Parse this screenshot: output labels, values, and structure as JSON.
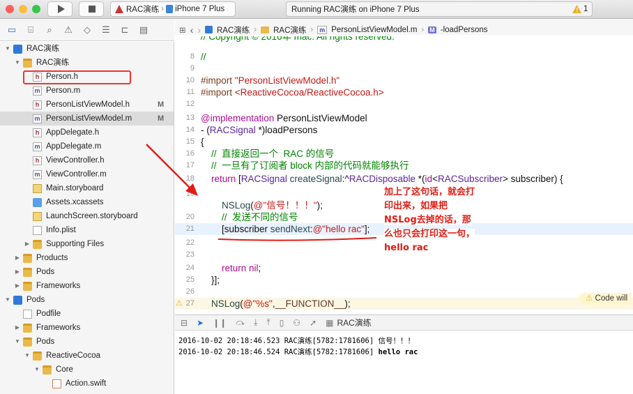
{
  "toolbar": {
    "target_name": "RAC演练",
    "device_name": "iPhone 7 Plus",
    "status_text": "Running RAC演练 on iPhone 7 Plus",
    "warning_count": "1",
    "colors": {
      "close": "#fc605b",
      "minimize": "#fdbc40",
      "zoom": "#34c84a"
    }
  },
  "navigator": {
    "items": [
      {
        "label": "RAC演练",
        "icon": "project-icon",
        "indent": 0,
        "disclosure": "open",
        "badge": ""
      },
      {
        "label": "RAC演练",
        "icon": "folder-icon",
        "indent": 1,
        "disclosure": "open",
        "badge": ""
      },
      {
        "label": "Person.h",
        "icon": "h-file-icon",
        "indent": 2,
        "disclosure": "",
        "badge": ""
      },
      {
        "label": "Person.m",
        "icon": "m-file-icon",
        "indent": 2,
        "disclosure": "",
        "badge": ""
      },
      {
        "label": "PersonListViewModel.h",
        "icon": "h-file-icon",
        "indent": 2,
        "disclosure": "",
        "badge": "M"
      },
      {
        "label": "PersonListViewModel.m",
        "icon": "m-file-icon",
        "indent": 2,
        "disclosure": "",
        "badge": "M",
        "selected": true
      },
      {
        "label": "AppDelegate.h",
        "icon": "h-file-icon",
        "indent": 2,
        "disclosure": "",
        "badge": ""
      },
      {
        "label": "AppDelegate.m",
        "icon": "m-file-icon",
        "indent": 2,
        "disclosure": "",
        "badge": ""
      },
      {
        "label": "ViewController.h",
        "icon": "h-file-icon",
        "indent": 2,
        "disclosure": "",
        "badge": ""
      },
      {
        "label": "ViewController.m",
        "icon": "m-file-icon",
        "indent": 2,
        "disclosure": "",
        "badge": ""
      },
      {
        "label": "Main.storyboard",
        "icon": "storyboard-icon",
        "indent": 2,
        "disclosure": "",
        "badge": ""
      },
      {
        "label": "Assets.xcassets",
        "icon": "assets-icon",
        "indent": 2,
        "disclosure": "",
        "badge": ""
      },
      {
        "label": "LaunchScreen.storyboard",
        "icon": "storyboard-icon",
        "indent": 2,
        "disclosure": "",
        "badge": ""
      },
      {
        "label": "Info.plist",
        "icon": "plist-icon",
        "indent": 2,
        "disclosure": "",
        "badge": ""
      },
      {
        "label": "Supporting Files",
        "icon": "folder-icon",
        "indent": 2,
        "disclosure": "closed",
        "badge": ""
      },
      {
        "label": "Products",
        "icon": "folder-icon",
        "indent": 1,
        "disclosure": "closed",
        "badge": ""
      },
      {
        "label": "Pods",
        "icon": "folder-icon",
        "indent": 1,
        "disclosure": "closed",
        "badge": ""
      },
      {
        "label": "Frameworks",
        "icon": "folder-icon",
        "indent": 1,
        "disclosure": "closed",
        "badge": ""
      },
      {
        "label": "Pods",
        "icon": "project-icon",
        "indent": 0,
        "disclosure": "open",
        "badge": ""
      },
      {
        "label": "Podfile",
        "icon": "plist-icon",
        "indent": 1,
        "disclosure": "",
        "badge": ""
      },
      {
        "label": "Frameworks",
        "icon": "folder-icon",
        "indent": 1,
        "disclosure": "closed",
        "badge": ""
      },
      {
        "label": "Pods",
        "icon": "folder-icon",
        "indent": 1,
        "disclosure": "open",
        "badge": ""
      },
      {
        "label": "ReactiveCocoa",
        "icon": "folder-icon",
        "indent": 2,
        "disclosure": "open",
        "badge": ""
      },
      {
        "label": "Core",
        "icon": "folder-icon",
        "indent": 3,
        "disclosure": "open",
        "badge": ""
      },
      {
        "label": "Action.swift",
        "icon": "swift-icon",
        "indent": 4,
        "disclosure": "",
        "badge": ""
      }
    ]
  },
  "jumpbar": {
    "crumbs": [
      "RAC演练",
      "RAC演练",
      "PersonListViewModel.m",
      "-loadPersons"
    ]
  },
  "editor": {
    "lines": [
      {
        "n": "8",
        "spans": [
          {
            "c": "cm",
            "t": "//"
          }
        ]
      },
      {
        "n": "9",
        "spans": []
      },
      {
        "n": "10",
        "spans": [
          {
            "c": "pp",
            "t": "#import "
          },
          {
            "c": "str",
            "t": "\"PersonListViewModel.h\""
          }
        ]
      },
      {
        "n": "11",
        "spans": [
          {
            "c": "pp",
            "t": "#import "
          },
          {
            "c": "str",
            "t": "<ReactiveCocoa/ReactiveCocoa.h>"
          }
        ]
      },
      {
        "n": "12",
        "spans": []
      },
      {
        "n": "13",
        "spans": [
          {
            "c": "kw",
            "t": "@implementation "
          },
          {
            "c": "plain",
            "t": "PersonListViewModel"
          }
        ]
      },
      {
        "n": "14",
        "spans": [
          {
            "c": "plain",
            "t": "- ("
          },
          {
            "c": "cls",
            "t": "RACSignal"
          },
          {
            "c": "plain",
            "t": " *)loadPersons"
          }
        ]
      },
      {
        "n": "15",
        "spans": [
          {
            "c": "plain",
            "t": "{"
          }
        ]
      },
      {
        "n": "16",
        "spans": [
          {
            "c": "cm",
            "t": "    //  直接返回一个  RAC 的信号"
          }
        ]
      },
      {
        "n": "17",
        "spans": [
          {
            "c": "cm",
            "t": "    //  一旦有了订阅者 block 内部的代码就能够执行"
          }
        ]
      },
      {
        "n": "18",
        "spans": [
          {
            "c": "kw",
            "t": "    return "
          },
          {
            "c": "plain",
            "t": "["
          },
          {
            "c": "cls",
            "t": "RACSignal"
          },
          {
            "c": "plain",
            "t": " "
          },
          {
            "c": "fn",
            "t": "createSignal"
          },
          {
            "c": "plain",
            "t": ":^"
          },
          {
            "c": "cls",
            "t": "RACDisposable"
          },
          {
            "c": "plain",
            "t": " *("
          },
          {
            "c": "kw",
            "t": "id"
          },
          {
            "c": "plain",
            "t": "<"
          },
          {
            "c": "cls",
            "t": "RACSubscriber"
          },
          {
            "c": "plain",
            "t": "> subscriber) {"
          }
        ]
      },
      {
        "n": "19",
        "spans": []
      },
      {
        "n": "",
        "spans": [
          {
            "c": "plain",
            "t": "        "
          },
          {
            "c": "fn",
            "t": "NSLog"
          },
          {
            "c": "plain",
            "t": "("
          },
          {
            "c": "str",
            "t": "@\"信号！！！\""
          },
          {
            "c": "plain",
            "t": ");"
          }
        ]
      },
      {
        "n": "20",
        "spans": [
          {
            "c": "cm",
            "t": "        //  发送不同的信号"
          }
        ]
      },
      {
        "n": "21",
        "spans": [
          {
            "c": "plain",
            "t": "        [subscriber "
          },
          {
            "c": "fn",
            "t": "sendNext"
          },
          {
            "c": "plain",
            "t": ":"
          },
          {
            "c": "str",
            "t": "@\"hello rac\""
          },
          {
            "c": "plain",
            "t": "];"
          }
        ]
      },
      {
        "n": "22",
        "spans": []
      },
      {
        "n": "23",
        "spans": []
      },
      {
        "n": "24",
        "spans": [
          {
            "c": "kw",
            "t": "        return "
          },
          {
            "c": "kw",
            "t": "nil"
          },
          {
            "c": "plain",
            "t": ";"
          }
        ]
      },
      {
        "n": "25",
        "spans": [
          {
            "c": "plain",
            "t": "    }];"
          }
        ]
      },
      {
        "n": "26",
        "spans": []
      },
      {
        "n": "27",
        "spans": [
          {
            "c": "plain",
            "t": "    "
          },
          {
            "c": "fn",
            "t": "NSLog"
          },
          {
            "c": "plain",
            "t": "("
          },
          {
            "c": "str",
            "t": "@\"%s\""
          },
          {
            "c": "plain",
            "t": ","
          },
          {
            "c": "mac",
            "t": "__FUNCTION__"
          },
          {
            "c": "plain",
            "t": ");"
          }
        ]
      }
    ],
    "top_comment": "// Copyright © 2016年 mac. All rights reserved.",
    "warning_pill": "Code will"
  },
  "annotation": {
    "lines": [
      "加上了这句话，就会打",
      "印出来，如果把",
      "NSLog去掉的话，那",
      "么也只会打印这一句，",
      "hello rac"
    ],
    "color": "#e21c13"
  },
  "debugbar": {
    "process": "RAC演练"
  },
  "console": {
    "lines": [
      "2016-10-02 20:18:46.523 RAC演练[5782:1781606] 信号！！！",
      "2016-10-02 20:18:46.524 RAC演练[5782:1781606] hello rac"
    ]
  }
}
